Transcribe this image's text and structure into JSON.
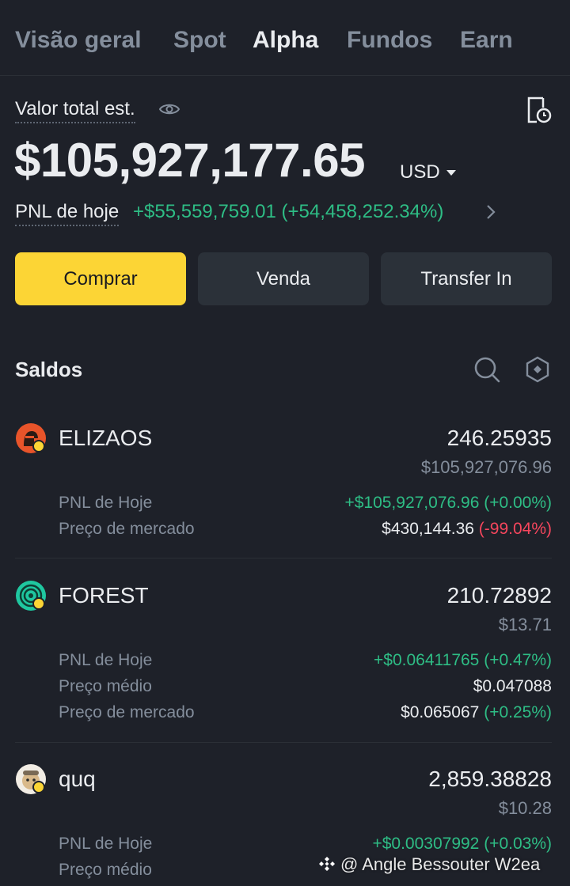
{
  "tabs": [
    {
      "label": "Visão geral",
      "active": false
    },
    {
      "label": "Spot",
      "active": false
    },
    {
      "label": "Alpha",
      "active": true
    },
    {
      "label": "Fundos",
      "active": false
    },
    {
      "label": "Earn",
      "active": false
    }
  ],
  "summary": {
    "total_label": "Valor total est.",
    "total_value": "$105,927,177.65",
    "currency": "USD",
    "pnl_label": "PNL de hoje",
    "pnl_value": "+$55,559,759.01 (+54,458,252.34%)"
  },
  "actions": {
    "buy": "Comprar",
    "sell": "Venda",
    "transfer": "Transfer In"
  },
  "balances": {
    "title": "Saldos",
    "assets": [
      {
        "name": "ELIZAOS",
        "amount": "246.25935",
        "usd_value": "$105,927,076.96",
        "rows": [
          {
            "label": "PNL de Hoje",
            "value": "+$105,927,076.96 (+0.00%)"
          },
          {
            "label": "Preço de mercado",
            "value": "$430,144.36",
            "change": "(-99.04%)"
          }
        ]
      },
      {
        "name": "FOREST",
        "amount": "210.72892",
        "usd_value": "$13.71",
        "rows": [
          {
            "label": "PNL de Hoje",
            "value": "+$0.06411765 (+0.47%)"
          },
          {
            "label": "Preço médio",
            "value": "$0.047088"
          },
          {
            "label": "Preço de mercado",
            "value": "$0.065067",
            "change": "(+0.25%)"
          }
        ]
      },
      {
        "name": "quq",
        "amount": "2,859.38828",
        "usd_value": "$10.28",
        "rows": [
          {
            "label": "PNL de Hoje",
            "value": "+$0.00307992 (+0.03%)"
          },
          {
            "label": "Preço médio",
            "value": ""
          }
        ]
      }
    ]
  },
  "watermark": "@ Angle Bessouter W2ea",
  "colors": {
    "background": "#1e2129",
    "accent": "#fcd535",
    "positive": "#2ebd85",
    "negative": "#f6465d",
    "muted": "#848e9c"
  }
}
